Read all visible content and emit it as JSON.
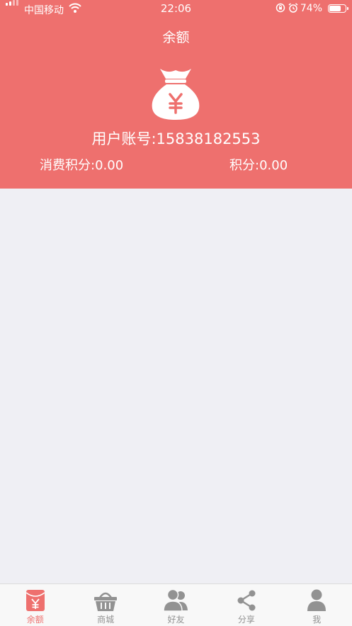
{
  "status_bar": {
    "carrier": "中国移动",
    "time": "22:06",
    "battery": "74%"
  },
  "header": {
    "title": "余额",
    "account_label": "用户账号:",
    "account_value": "15838182553",
    "consume_points_label": "消费积分:",
    "consume_points_value": "0.00",
    "points_label": "积分:",
    "points_value": "0.00"
  },
  "tabbar": {
    "items": [
      {
        "label": "余额",
        "active": true
      },
      {
        "label": "商城",
        "active": false
      },
      {
        "label": "好友",
        "active": false
      },
      {
        "label": "分享",
        "active": false
      },
      {
        "label": "我",
        "active": false
      }
    ]
  },
  "colors": {
    "accent": "#EE706E",
    "background": "#EFEFF4",
    "tab_inactive": "#929292"
  }
}
